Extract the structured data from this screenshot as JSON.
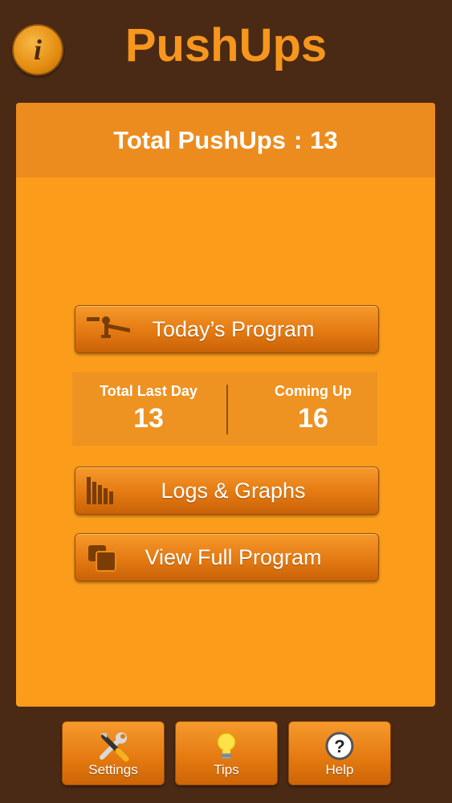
{
  "header": {
    "info_symbol": "i",
    "title": "PushUps"
  },
  "summary": {
    "total_label": "Total PushUps",
    "separator": ":",
    "total_value": "13"
  },
  "actions": {
    "todays_program": "Today’s Program",
    "logs_graphs": "Logs & Graphs",
    "view_full_program": "View Full Program"
  },
  "stats": {
    "last_day_label": "Total Last Day",
    "last_day_value": "13",
    "coming_up_label": "Coming Up",
    "coming_up_value": "16"
  },
  "tabs": [
    {
      "label": "Settings",
      "icon": "tools-icon"
    },
    {
      "label": "Tips",
      "icon": "lightbulb-icon"
    },
    {
      "label": "Help",
      "icon": "question-icon"
    }
  ],
  "colors": {
    "background": "#4a2a14",
    "accent": "#f6961c",
    "card": "#fb9d1b"
  }
}
